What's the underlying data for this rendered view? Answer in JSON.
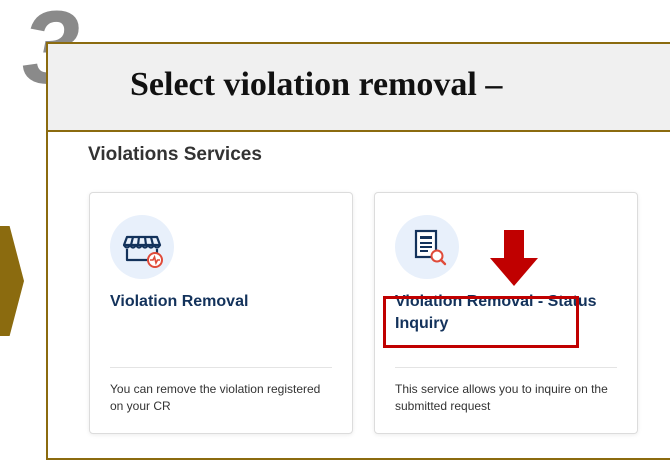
{
  "step": {
    "number": "3"
  },
  "header": {
    "title": "Select violation removal –"
  },
  "section": {
    "heading": "Violations Services"
  },
  "cards": [
    {
      "title": "Violation Removal",
      "description": "You can remove the violation registered on your CR",
      "icon": "shop-icon"
    },
    {
      "title": "Violation Removal - Status Inquiry",
      "description": "This service allows you to inquire on the submitted request",
      "icon": "document-search-icon"
    }
  ],
  "colors": {
    "frame": "#8b6b0f",
    "highlight": "#c00000",
    "card_title": "#13325b",
    "icon_bg": "#e8f0fb"
  }
}
